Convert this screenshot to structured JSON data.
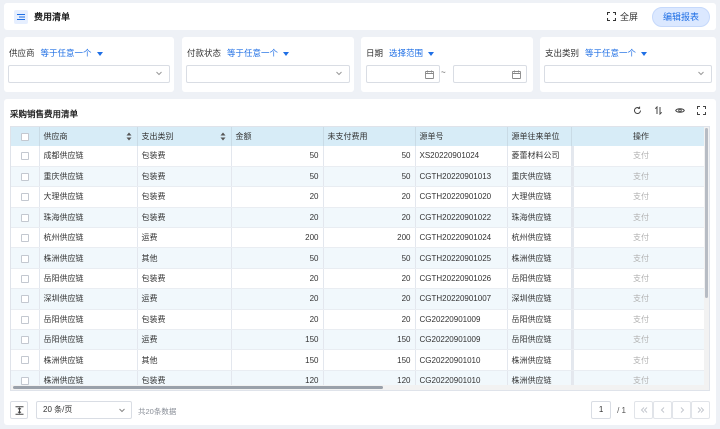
{
  "header": {
    "title": "费用清单",
    "fullscreen_label": "全屏",
    "edit_label": "编辑报表"
  },
  "filters": {
    "supplier": {
      "label": "供应商",
      "op": "等于任意一个"
    },
    "pay_status": {
      "label": "付款状态",
      "op": "等于任意一个"
    },
    "date": {
      "label": "日期",
      "op": "选择范围",
      "separator": "~"
    },
    "expense_type": {
      "label": "支出类别",
      "op": "等于任意一个"
    }
  },
  "table": {
    "title": "采购销售费用清单",
    "columns": [
      "供应商",
      "支出类别",
      "金额",
      "未支付费用",
      "源单号",
      "源单往来单位",
      "操作"
    ],
    "rows": [
      [
        "成都供应链",
        "包装费",
        "50",
        "50",
        "XS20220901024",
        "菱蕾材料公司",
        "支付"
      ],
      [
        "重庆供应链",
        "包装费",
        "50",
        "50",
        "CGTH20220901013",
        "重庆供应链",
        "支付"
      ],
      [
        "大理供应链",
        "包装费",
        "20",
        "20",
        "CGTH20220901020",
        "大理供应链",
        "支付"
      ],
      [
        "珠海供应链",
        "包装费",
        "20",
        "20",
        "CGTH20220901022",
        "珠海供应链",
        "支付"
      ],
      [
        "杭州供应链",
        "运费",
        "200",
        "200",
        "CGTH20220901024",
        "杭州供应链",
        "支付"
      ],
      [
        "株洲供应链",
        "其他",
        "50",
        "50",
        "CGTH20220901025",
        "株洲供应链",
        "支付"
      ],
      [
        "岳阳供应链",
        "包装费",
        "20",
        "20",
        "CGTH20220901026",
        "岳阳供应链",
        "支付"
      ],
      [
        "深圳供应链",
        "运费",
        "20",
        "20",
        "CGTH20220901007",
        "深圳供应链",
        "支付"
      ],
      [
        "岳阳供应链",
        "包装费",
        "20",
        "20",
        "CG20220901009",
        "岳阳供应链",
        "支付"
      ],
      [
        "岳阳供应链",
        "运费",
        "150",
        "150",
        "CG20220901009",
        "岳阳供应链",
        "支付"
      ],
      [
        "株洲供应链",
        "其他",
        "150",
        "150",
        "CG20220901010",
        "株洲供应链",
        "支付"
      ],
      [
        "株洲供应链",
        "包装费",
        "120",
        "120",
        "CG20220901010",
        "株洲供应链",
        "支付"
      ]
    ]
  },
  "footer": {
    "page_size": "20 条/页",
    "total": "共20条数据",
    "page": "1",
    "page_of": "/ 1"
  }
}
